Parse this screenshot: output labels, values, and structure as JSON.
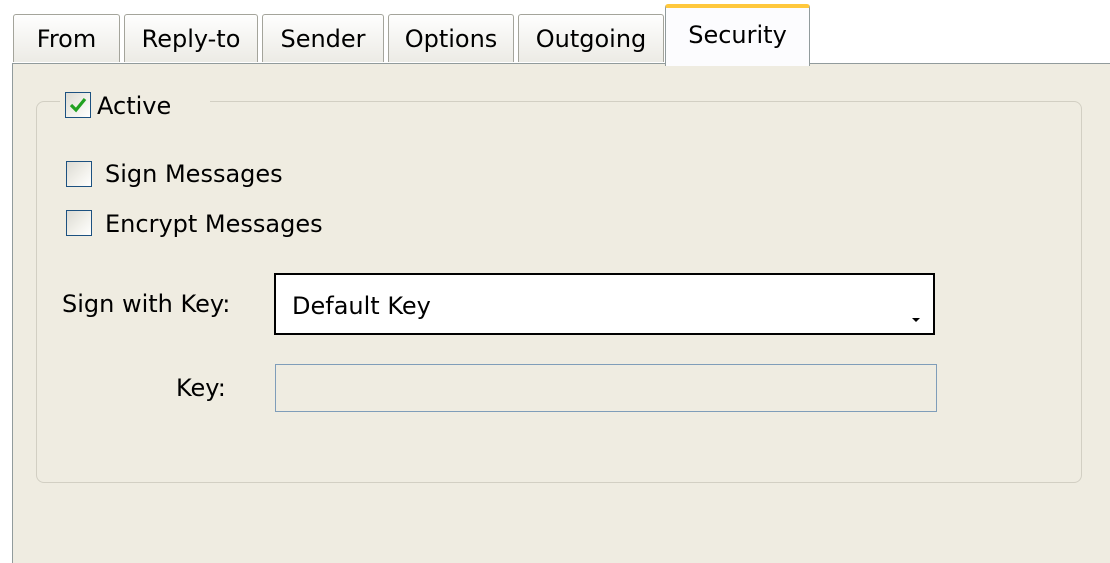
{
  "tabs": [
    {
      "label": "From"
    },
    {
      "label": "Reply-to"
    },
    {
      "label": "Sender"
    },
    {
      "label": "Options"
    },
    {
      "label": "Outgoing"
    },
    {
      "label": "Security",
      "active": true
    }
  ],
  "security": {
    "active": {
      "label": "Active",
      "checked": true
    },
    "sign_messages": {
      "label": "Sign Messages",
      "checked": false
    },
    "encrypt_messages": {
      "label": "Encrypt Messages",
      "checked": false
    },
    "sign_with_key": {
      "label": "Sign with Key:",
      "value": "Default Key"
    },
    "key": {
      "label": "Key:",
      "value": ""
    }
  },
  "colors": {
    "active_tab_accent": "#ffc83c",
    "checkmark": "#21a121",
    "panel_bg": "#efece1"
  }
}
